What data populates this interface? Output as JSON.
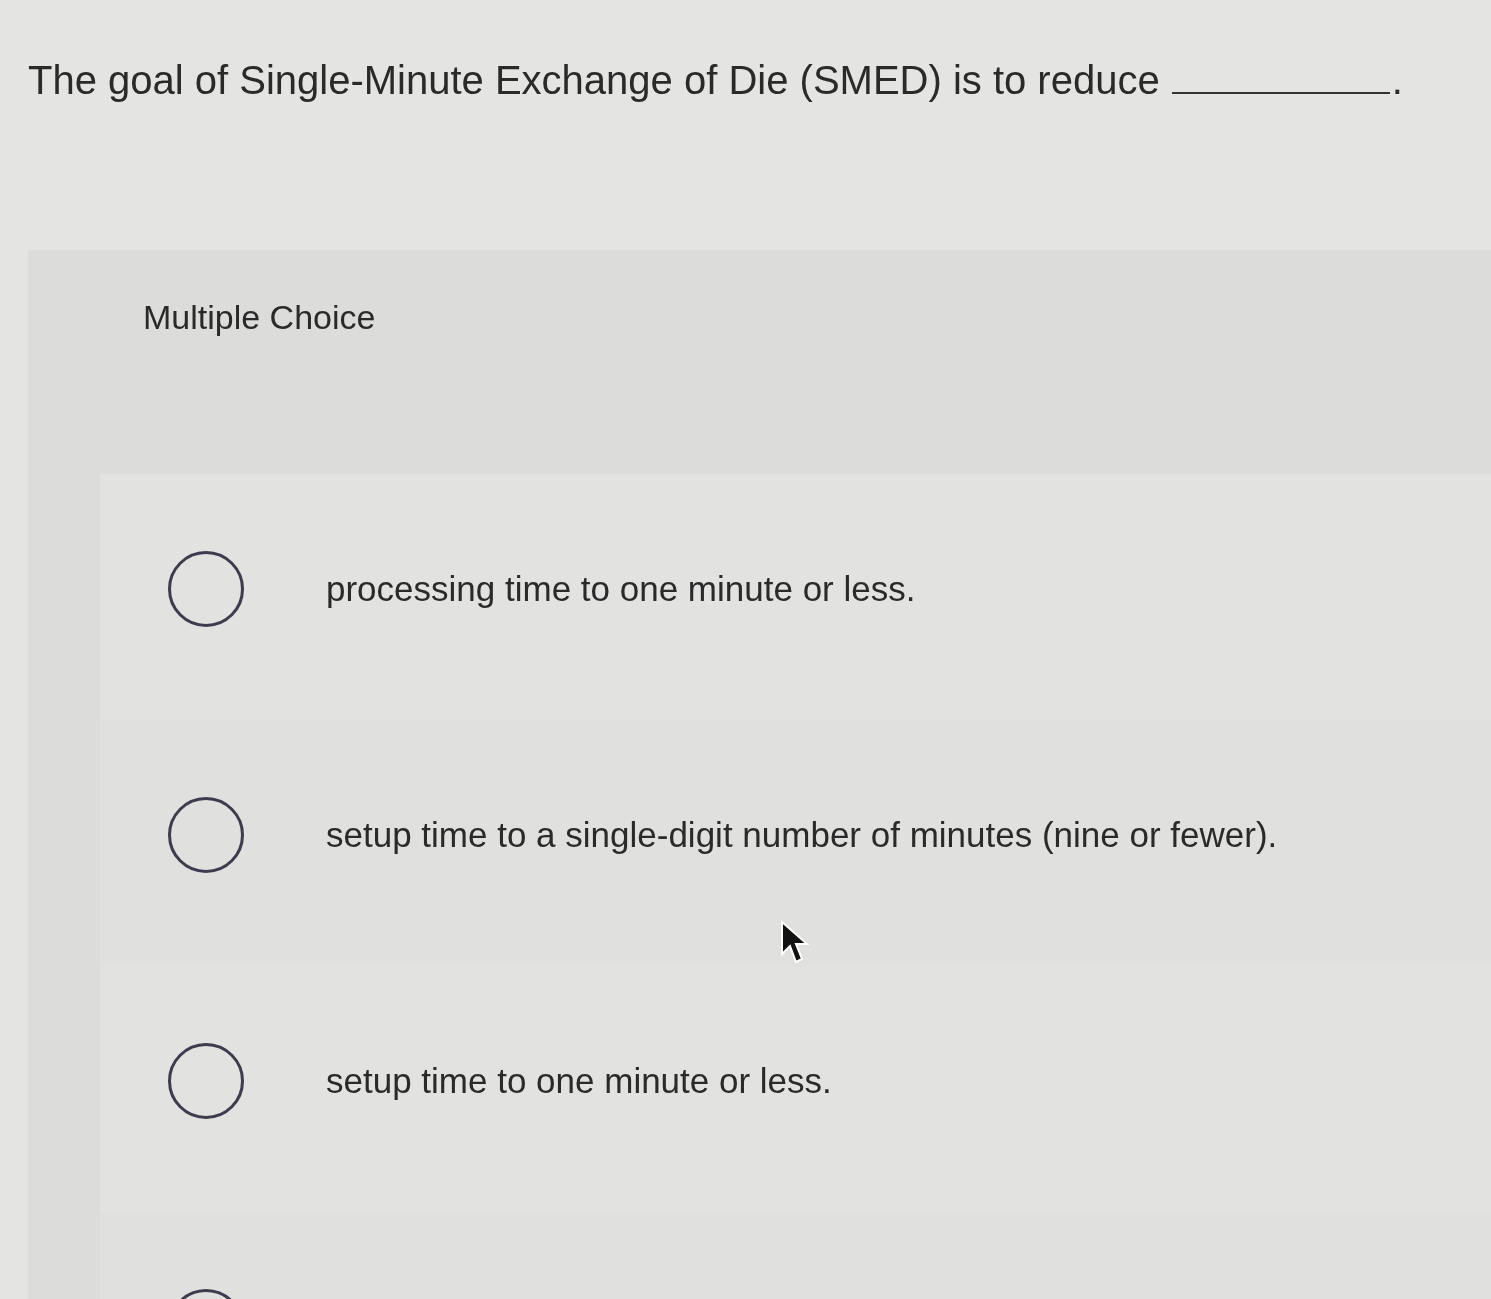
{
  "question": {
    "text": "The goal of Single-Minute Exchange of Die (SMED) is to reduce",
    "end": "."
  },
  "section": {
    "title": "Multiple Choice"
  },
  "options": [
    {
      "label": "processing time to one minute or less.",
      "selected": false
    },
    {
      "label": "setup time to a single-digit number of minutes (nine or fewer).",
      "selected": false
    },
    {
      "label": "setup time to one minute or less.",
      "selected": false
    },
    {
      "selected": false
    }
  ]
}
